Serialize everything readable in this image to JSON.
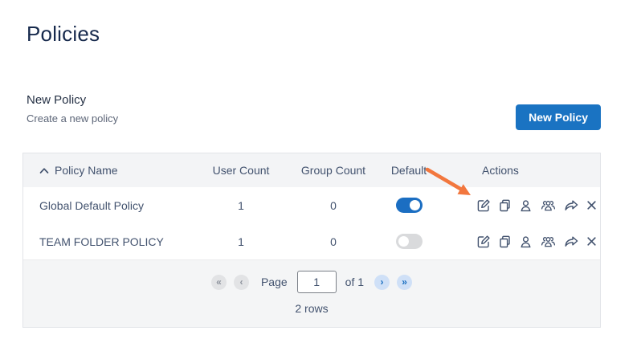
{
  "page": {
    "title": "Policies"
  },
  "new_policy_section": {
    "heading": "New Policy",
    "description": "Create a new policy",
    "button_label": "New Policy"
  },
  "table": {
    "columns": {
      "policy_name": "Policy Name",
      "user_count": "User Count",
      "group_count": "Group Count",
      "default": "Default",
      "actions": "Actions"
    },
    "sort": {
      "column": "Policy Name",
      "direction": "ascending"
    },
    "rows": [
      {
        "policy_name": "Global Default Policy",
        "user_count": "1",
        "group_count": "0",
        "default_enabled": true
      },
      {
        "policy_name": "TEAM FOLDER POLICY",
        "user_count": "1",
        "group_count": "0",
        "default_enabled": false
      }
    ],
    "row_actions": [
      "edit",
      "copy",
      "assign-user",
      "assign-group",
      "share",
      "remove"
    ]
  },
  "pagination": {
    "first_label": "«",
    "prev_label": "‹",
    "page_label": "Page",
    "page_value": "1",
    "of_label": "of 1",
    "next_label": "›",
    "last_label": "»",
    "rows_summary": "2 rows"
  },
  "annotation": {
    "arrow_color": "#F2773E"
  },
  "colors": {
    "accent_blue": "#1A73C2",
    "toggle_on": "#1B6EC2",
    "toggle_off": "#D9DADC",
    "header_bg": "#F3F4F6",
    "table_border": "#E2E4E8",
    "text_slate": "#42526E",
    "title_navy": "#16294C",
    "pager_enabled_bg": "#CFE0F7",
    "pager_disabled_bg": "#E2E3E5"
  }
}
